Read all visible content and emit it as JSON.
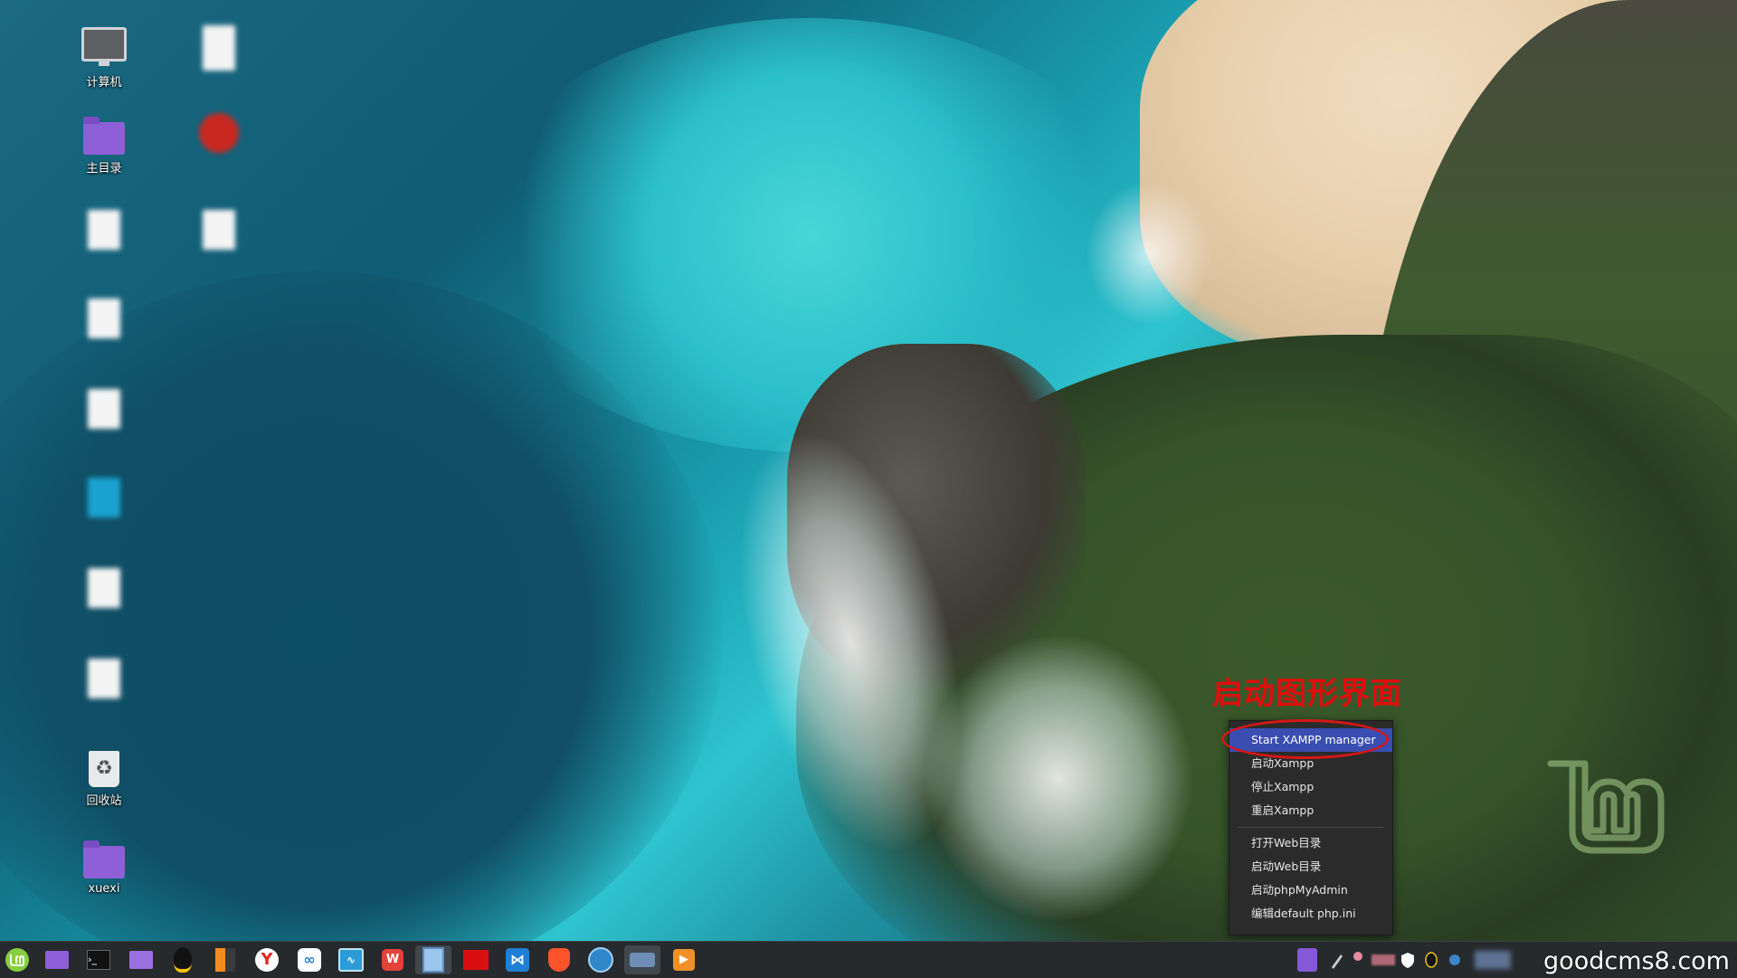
{
  "desktop": {
    "icons": [
      {
        "label": "计算机",
        "icon": "computer-icon"
      },
      {
        "label": "主目录",
        "icon": "home-folder-icon"
      },
      {
        "label": "回收站",
        "icon": "trash-icon"
      },
      {
        "label": "xuexi",
        "icon": "folder-icon"
      }
    ]
  },
  "annotation": {
    "text": "启动图形界面",
    "color": "#e00d0d"
  },
  "context_menu": {
    "items": [
      {
        "label": "Start XAMPP manager",
        "highlighted": true
      },
      {
        "label": "启动Xampp"
      },
      {
        "label": "停止Xampp"
      },
      {
        "label": "重启Xampp"
      },
      {
        "label": "打开Web目录"
      },
      {
        "label": "启动Web目录"
      },
      {
        "label": "启动phpMyAdmin"
      },
      {
        "label": "编辑default php.ini"
      }
    ]
  },
  "watermark": {
    "text": "goodcms8.com"
  },
  "taskbar": {
    "launchers": [
      "mint-menu-icon",
      "files-icon",
      "terminal-icon",
      "folder-icon",
      "qq-icon",
      "sublime-icon",
      "yandex-icon",
      "baidu-netdisk-icon",
      "system-monitor-icon",
      "wps-icon",
      "window-icon",
      "screenshot-icon",
      "vscode-icon",
      "brave-icon",
      "deepin-icon",
      "settings-icon",
      "media-player-icon"
    ],
    "tray": [
      "xampp-tray-icon",
      "pen-icon",
      "pin-icon",
      "bar-icon",
      "shield-icon",
      "qq-tray-icon",
      "network-icon"
    ]
  },
  "colors": {
    "menu_bg": "#2b2b2b",
    "menu_highlight": "#3a4db0",
    "panel_bg": "#262a2d",
    "annotation_red": "#e00d0d"
  }
}
